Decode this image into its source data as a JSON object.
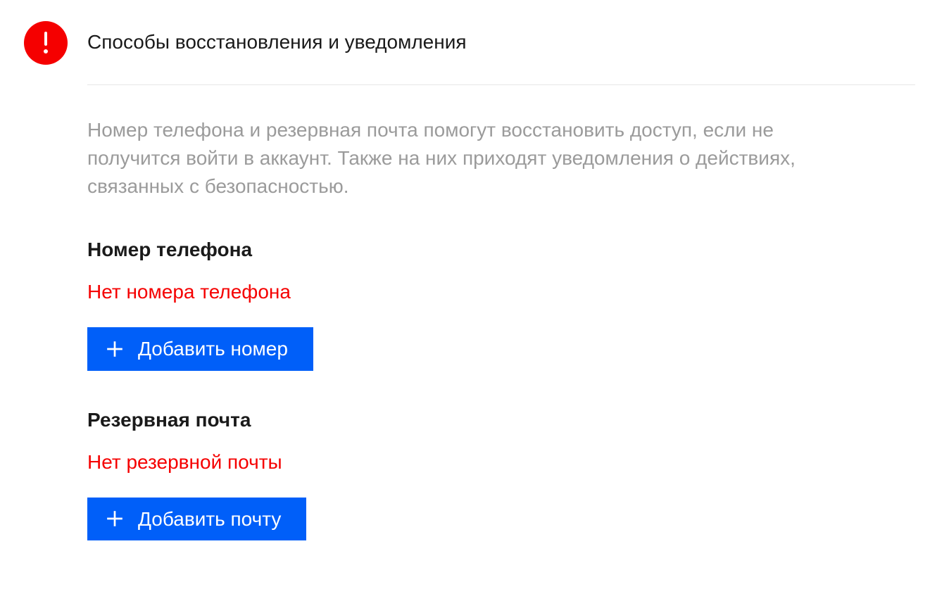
{
  "section": {
    "title": "Способы восстановления и уведомления",
    "description": "Номер телефона и резервная почта помогут восстановить доступ, если не получится войти в аккаунт. Также на них приходят уведомления о действиях, связанных с безопасностью."
  },
  "phone": {
    "heading": "Номер телефона",
    "status": "Нет номера телефона",
    "button_label": "Добавить номер"
  },
  "email": {
    "heading": "Резервная почта",
    "status": "Нет резервной почты",
    "button_label": "Добавить почту"
  },
  "colors": {
    "alert": "#f50000",
    "primary": "#005ff9"
  }
}
